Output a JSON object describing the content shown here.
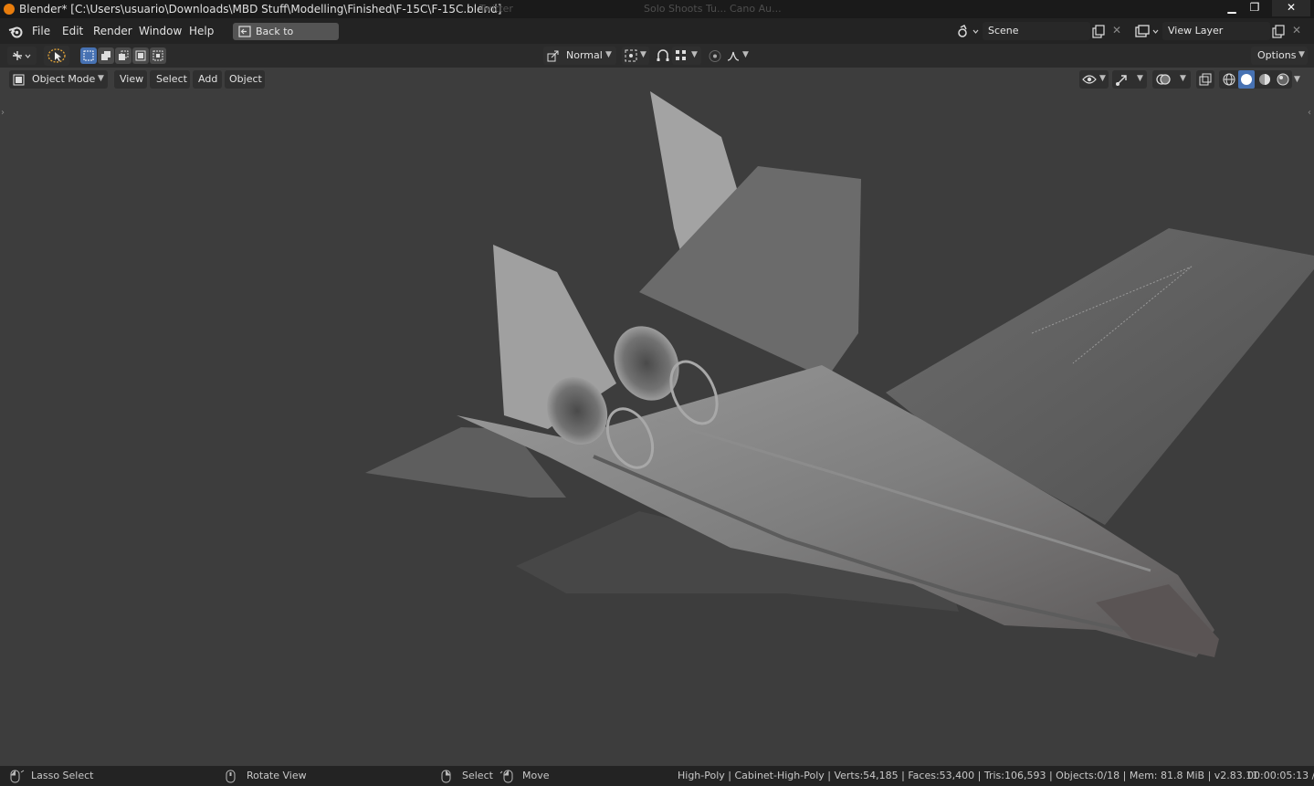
{
  "window": {
    "title": "Blender* [C:\\Users\\usuario\\Downloads\\MBD Stuff\\Modelling\\Finished\\F-15C\\F-15C.blend]",
    "ghost_tabs": [
      "Twitter",
      "Solo Shoots Tu... Cano Au..."
    ],
    "minimize": "▁",
    "restore": "❐",
    "close": "✕"
  },
  "menubar": {
    "items": [
      "File",
      "Edit",
      "Render",
      "Window",
      "Help"
    ],
    "back_button": "Back to Previous",
    "scene_field": "Scene",
    "view_layer_field": "View Layer"
  },
  "tool_header": {
    "orientation": "Normal",
    "options": "Options"
  },
  "viewport_header": {
    "mode": "Object Mode",
    "menus": [
      "View",
      "Select",
      "Add",
      "Object"
    ]
  },
  "statusbar": {
    "lasso": "Lasso Select",
    "rotate": "Rotate View",
    "select": "Select",
    "move": "Move",
    "stats": "High-Poly | Cabinet-High-Poly | Verts:54,185 | Faces:53,400 | Tris:106,593 | Objects:0/18 | Mem: 81.8 MiB | v2.83.11",
    "time": "00:00:05:13 /"
  },
  "colors": {
    "accent_blue": "#4772b3",
    "bg_viewport": "#3d3d3d",
    "model_grey": "#8a8a8a"
  }
}
